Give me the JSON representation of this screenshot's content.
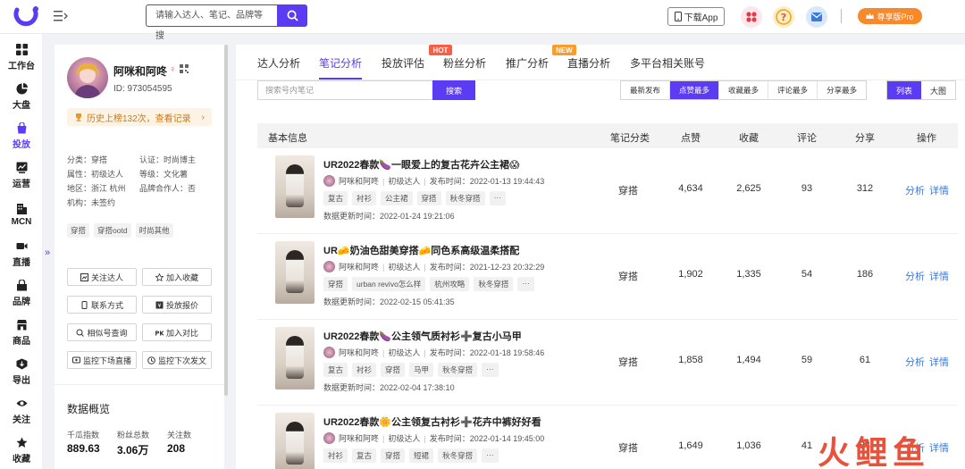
{
  "topbar": {
    "search_placeholder": "请输入达人、笔记、品牌等搜",
    "download_label": "下载App",
    "pro_label": "尊享版Pro",
    "colors": {
      "accent": "#5b3cf2",
      "pro": "#f7892a"
    }
  },
  "sidebar": {
    "items": [
      {
        "label": "工作台",
        "icon": "grid-icon"
      },
      {
        "label": "大盘",
        "icon": "pie-icon"
      },
      {
        "label": "投放",
        "icon": "bag-icon"
      },
      {
        "label": "运营",
        "icon": "chart-icon"
      },
      {
        "label": "MCN",
        "icon": "building-icon"
      },
      {
        "label": "直播",
        "icon": "video-icon"
      },
      {
        "label": "品牌",
        "icon": "brand-icon"
      },
      {
        "label": "商品",
        "icon": "shop-icon"
      },
      {
        "label": "导出",
        "icon": "export-icon"
      },
      {
        "label": "关注",
        "icon": "eye-icon"
      },
      {
        "label": "收藏",
        "icon": "star-icon"
      }
    ],
    "active_label": "投放"
  },
  "profile": {
    "name": "阿咪和阿咚",
    "id_text": "ID: 973054595",
    "history_text": "历史上榜132次，查看记录",
    "info": [
      [
        "分类：穿搭",
        "认证：时尚博主"
      ],
      [
        "属性：初级达人",
        "等级：文化薯"
      ],
      [
        "地区：浙江 杭州",
        "品牌合作人：否"
      ],
      [
        "机构：未签约",
        ""
      ]
    ],
    "tags": [
      "穿搭",
      "穿搭ootd",
      "时尚其他"
    ],
    "buttons": [
      {
        "label": "关注达人",
        "icon": "follow-icon"
      },
      {
        "label": "加入收藏",
        "icon": "star-icon"
      },
      {
        "label": "联系方式",
        "icon": "phone-icon"
      },
      {
        "label": "投放报价",
        "icon": "price-icon"
      },
      {
        "label": "相似号查询",
        "icon": "search-icon"
      },
      {
        "label": "加入对比",
        "icon": "pk-icon"
      },
      {
        "label": "监控下场直播",
        "icon": "monitor-icon"
      },
      {
        "label": "监控下次发文",
        "icon": "clock-icon"
      }
    ],
    "overview_title": "数据概览",
    "stats": [
      {
        "label": "千瓜指数",
        "value": "889.63"
      },
      {
        "label": "粉丝总数",
        "value": "3.06万"
      },
      {
        "label": "关注数",
        "value": "208"
      }
    ]
  },
  "main": {
    "tabs": [
      "达人分析",
      "笔记分析",
      "投放评估",
      "粉丝分析",
      "推广分析",
      "直播分析",
      "多平台相关账号"
    ],
    "active_tab": "笔记分析",
    "badge_hot": "HOT",
    "badge_new": "NEW",
    "note_search_placeholder": "搜索号内笔记",
    "note_search_button": "搜索",
    "sort_options": [
      "最新发布",
      "点赞最多",
      "收藏最多",
      "评论最多",
      "分享最多"
    ],
    "active_sort": "点赞最多",
    "view_options": [
      "列表",
      "大图"
    ],
    "active_view": "列表",
    "columns": [
      "基本信息",
      "笔记分类",
      "点赞",
      "收藏",
      "评论",
      "分享",
      "操作"
    ],
    "op_labels": [
      "分析",
      "详情"
    ],
    "rows": [
      {
        "title": "UR2022春款🍆一眼爱上的复古花卉公主裙😱",
        "author": "阿咪和阿咚",
        "level": "初级达人",
        "publish": "发布时间：2022-01-13 19:44:43",
        "tags": [
          "复古",
          "衬衫",
          "公主裙",
          "穿搭",
          "秋冬穿搭",
          "···"
        ],
        "updated": "数据更新时间：2022-01-24 19:21:06",
        "category": "穿搭",
        "likes": "4,634",
        "collects": "2,625",
        "comments": "93",
        "shares": "312"
      },
      {
        "title": "UR🧀奶油色甜美穿搭🧀同色系高级温柔搭配",
        "author": "阿咪和阿咚",
        "level": "初级达人",
        "publish": "发布时间：2021-12-23 20:32:29",
        "tags": [
          "穿搭",
          "urban revivo怎么样",
          "杭州攻略",
          "秋冬穿搭",
          "···"
        ],
        "updated": "数据更新时间：2022-02-15 05:41:35",
        "category": "穿搭",
        "likes": "1,902",
        "collects": "1,335",
        "comments": "54",
        "shares": "186"
      },
      {
        "title": "UR2022春款🍆公主领气质衬衫➕复古小马甲",
        "author": "阿咪和阿咚",
        "level": "初级达人",
        "publish": "发布时间：2022-01-18 19:58:46",
        "tags": [
          "复古",
          "衬衫",
          "穿搭",
          "马甲",
          "秋冬穿搭",
          "···"
        ],
        "updated": "数据更新时间：2022-02-04 17:38:10",
        "category": "穿搭",
        "likes": "1,858",
        "collects": "1,494",
        "comments": "59",
        "shares": "61"
      },
      {
        "title": "UR2022春款🌼公主领复古衬衫➕花卉中裤好好看",
        "author": "阿咪和阿咚",
        "level": "初级达人",
        "publish": "发布时间：2022-01-14 19:45:00",
        "tags": [
          "衬衫",
          "复古",
          "穿搭",
          "短裙",
          "秋冬穿搭",
          "···"
        ],
        "updated": "",
        "category": "穿搭",
        "likes": "1,649",
        "collects": "1,036",
        "comments": "41",
        "shares": "84"
      }
    ]
  },
  "watermark": "火鲤鱼"
}
